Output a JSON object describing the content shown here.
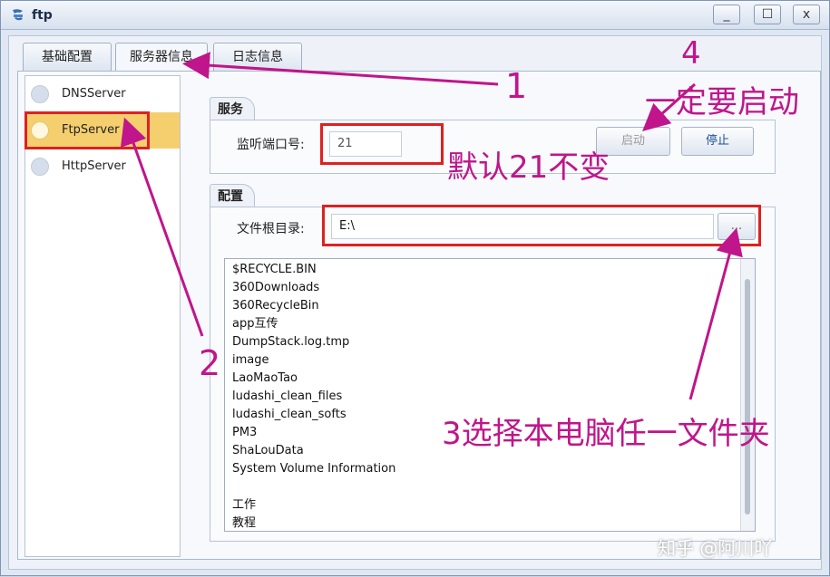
{
  "window": {
    "title": "ftp",
    "controls": [
      "_",
      "☐",
      "x"
    ]
  },
  "tabs": [
    {
      "label": "基础配置"
    },
    {
      "label": "服务器信息"
    },
    {
      "label": "日志信息"
    }
  ],
  "servers": [
    {
      "label": "DNSServer"
    },
    {
      "label": "FtpServer"
    },
    {
      "label": "HttpServer"
    }
  ],
  "service": {
    "group_title": "服务",
    "port_label": "监听端口号:",
    "port_value": "21",
    "start_label": "启动",
    "stop_label": "停止"
  },
  "config": {
    "group_title": "配置",
    "root_label": "文件根目录:",
    "root_value": "E:\\",
    "browse_label": "..."
  },
  "files": [
    "$RECYCLE.BIN",
    "360Downloads",
    "360RecycleBin",
    "app互传",
    "DumpStack.log.tmp",
    "image",
    "LaoMaoTao",
    "ludashi_clean_files",
    "ludashi_clean_softs",
    "PM3",
    "ShaLouData",
    "System Volume Information",
    "",
    "工作",
    "教程"
  ],
  "annotations": {
    "n1": "1",
    "n2": "2",
    "n4": "4",
    "must_start": "一定要启动",
    "default_21": "默认21不变",
    "choose_folder": "3选择本电脑任一文件夹",
    "color": "#c0158b"
  },
  "watermark": "知乎 @阿川吖"
}
